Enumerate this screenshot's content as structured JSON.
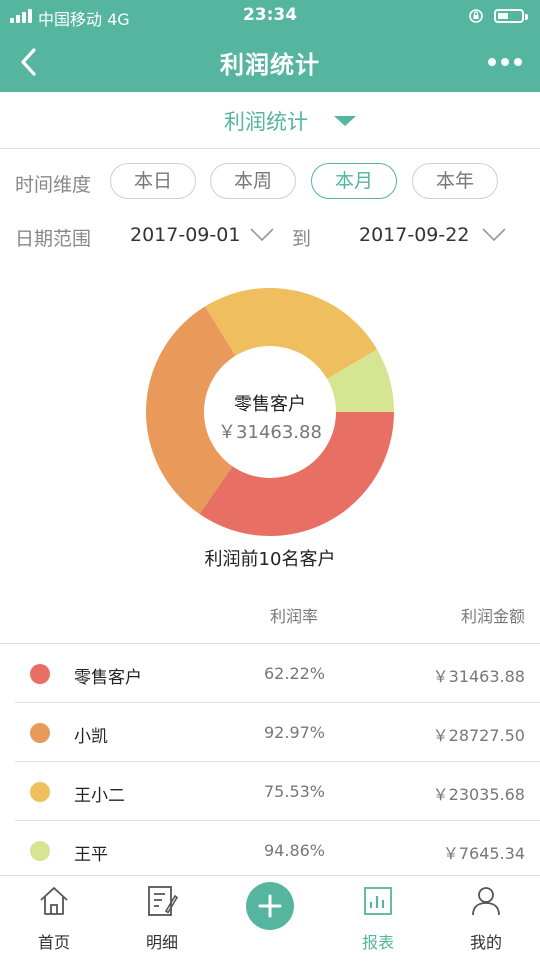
{
  "status_bar": {
    "carrier": "中国移动  4G",
    "time": "23:34"
  },
  "nav": {
    "title": "利润统计"
  },
  "dropdown": {
    "label": "利润统计"
  },
  "time_dimension": {
    "label": "时间维度",
    "options": [
      "本日",
      "本周",
      "本月",
      "本年"
    ],
    "selected": "本月"
  },
  "date_range": {
    "label": "日期范围",
    "start": "2017-09-01",
    "to_label": "到",
    "end": "2017-09-22"
  },
  "chart_data": {
    "type": "pie",
    "title": "利润前10名客户",
    "center_name": "零售客户",
    "center_value": "￥31463.88",
    "slices": [
      {
        "name": "零售客户",
        "value": 31463.88,
        "color": "#e76f63"
      },
      {
        "name": "小凯",
        "value": 28727.5,
        "color": "#e99a5a"
      },
      {
        "name": "王小二",
        "value": 23035.68,
        "color": "#efbe5f"
      },
      {
        "name": "王平",
        "value": 7645.34,
        "color": "#d5e592"
      }
    ]
  },
  "table": {
    "headers": {
      "rate": "利润率",
      "amount": "利润金额"
    },
    "rows": [
      {
        "name": "零售客户",
        "rate": "62.22%",
        "amount": "￥31463.88",
        "color": "#e76f63"
      },
      {
        "name": "小凯",
        "rate": "92.97%",
        "amount": "￥28727.50",
        "color": "#e99a5a"
      },
      {
        "name": "王小二",
        "rate": "75.53%",
        "amount": "￥23035.68",
        "color": "#efbe5f"
      },
      {
        "name": "王平",
        "rate": "94.86%",
        "amount": "￥7645.34",
        "color": "#d5e592"
      }
    ]
  },
  "tab_bar": {
    "tabs": [
      {
        "label": "首页",
        "icon": "home-icon"
      },
      {
        "label": "明细",
        "icon": "edit-list-icon"
      },
      {
        "label": "",
        "icon": "plus-icon"
      },
      {
        "label": "报表",
        "icon": "report-icon"
      },
      {
        "label": "我的",
        "icon": "user-icon"
      }
    ]
  },
  "colors": {
    "primary": "#55b59f"
  }
}
